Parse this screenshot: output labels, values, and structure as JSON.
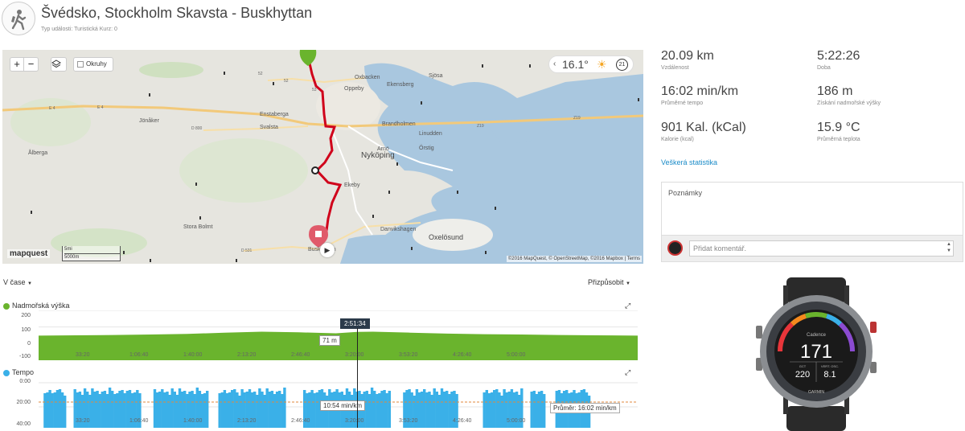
{
  "header": {
    "title": "Švédsko, Stockholm Skavsta - Buskhyttan",
    "subtitle": "Typ události: Turistická   Kurz: 0",
    "activity_icon": "hiking-icon"
  },
  "map": {
    "zoom_in": "+",
    "zoom_out": "−",
    "okruhy_label": "Okruhy",
    "temperature": "16.1°",
    "wind_value": "21",
    "logo": "mapquest",
    "scale_top": "5mi",
    "scale_bottom": "5000m",
    "attribution": "©2016 MapQuest, © OpenStreetMap, ©2016 Mapbox | Terms",
    "place_labels": [
      "Oppeby",
      "Nyköping",
      "Enstaberga",
      "Svalsta",
      "Jönåker",
      "Ålberga",
      "Stora Bolmt",
      "Ekeby",
      "Oxelösund",
      "Danvikshagen",
      "Brandholmen",
      "Arnö",
      "Örstig",
      "Linudden",
      "Ekensberg",
      "Oxbacken",
      "Sjösa",
      "Buskhyttan"
    ],
    "road_labels": [
      "E 4",
      "E 4",
      "52",
      "52",
      "53",
      "D 800",
      "Z19",
      "Z19",
      "D 531"
    ],
    "route_color": "#d0021b"
  },
  "stats": [
    {
      "value": "20.09 km",
      "label": "Vzdálenost"
    },
    {
      "value": "5:22:26",
      "label": "Doba"
    },
    {
      "value": "16:02 min/km",
      "label": "Průměrné tempo"
    },
    {
      "value": "186 m",
      "label": "Získání nadmořské výšky"
    },
    {
      "value": "901 Kal. (kCal)",
      "label": "Kalorie (kcal)"
    },
    {
      "value": "15.9 °C",
      "label": "Průměrná teplota"
    }
  ],
  "all_stats_link": "Veškerá statistika",
  "notes": {
    "label": "Poznámky",
    "comment_placeholder": "Přidat komentář."
  },
  "watch": {
    "screen_title": "Cadence",
    "main_value": "171",
    "left_label": "GCT",
    "left_value": "220",
    "right_label": "VERT. OSC.",
    "right_value": "8.1",
    "brand": "GARMIN"
  },
  "charts_controls": {
    "x_axis_mode": "V čase",
    "fit_label": "Přizpůsobit"
  },
  "chart_data": [
    {
      "type": "area",
      "title": "Nadmořská výška",
      "color": "#6ab42d",
      "y_ticks": [
        "200",
        "100",
        "0",
        "-100"
      ],
      "x_ticks": [
        "33:20",
        "1:06:40",
        "1:40:00",
        "2:13:20",
        "2:46:40",
        "3:20:00",
        "3:53:20",
        "4:26:40",
        "5:00:00"
      ],
      "cursor_time": "2:51:34",
      "cursor_value_label": "71 m",
      "x": [
        0,
        1200,
        2400,
        3600,
        4800,
        6000,
        7200,
        8400,
        9600,
        10294,
        10800,
        12000,
        13200,
        14400,
        15600,
        16800,
        18000,
        19346
      ],
      "values": [
        48,
        50,
        52,
        55,
        58,
        66,
        72,
        68,
        62,
        71,
        72,
        66,
        60,
        57,
        55,
        52,
        50,
        48
      ],
      "ylim": [
        -100,
        200
      ]
    },
    {
      "type": "area",
      "title": "Tempo",
      "color": "#3ab0e8",
      "y_ticks": [
        "0:00",
        "20:00",
        "40:00"
      ],
      "x_ticks": [
        "33:20",
        "1:06:40",
        "1:40:00",
        "2:13:20",
        "2:46:40",
        "3:20:00",
        "3:53:20",
        "4:26:40",
        "5:00:00"
      ],
      "cursor_value_label": "10:54 min/km",
      "average_label": "Průměr: 16:02 min/km",
      "average_value": 16.03,
      "gaps": [
        [
          2,
          3
        ],
        [
          30,
          31
        ],
        [
          47,
          48
        ],
        [
          63,
          64
        ],
        [
          93,
          94
        ],
        [
          137,
          138
        ]
      ]
    }
  ]
}
